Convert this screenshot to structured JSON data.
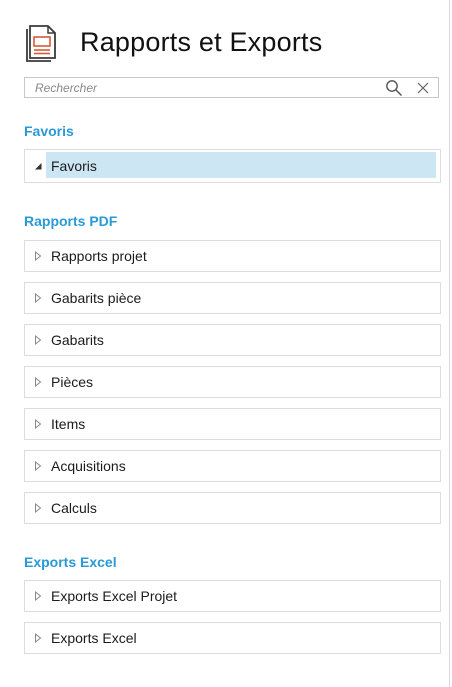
{
  "header": {
    "title": "Rapports et Exports",
    "icon": "report-document-icon"
  },
  "search": {
    "placeholder": "Rechercher",
    "value": "",
    "search_icon": "search-icon",
    "clear_icon": "close-icon"
  },
  "sections": {
    "favoris": {
      "title": "Favoris",
      "items": [
        {
          "label": "Favoris",
          "expanded": true
        }
      ]
    },
    "pdf": {
      "title": "Rapports PDF",
      "items": [
        {
          "label": "Rapports projet"
        },
        {
          "label": "Gabarits pièce"
        },
        {
          "label": "Gabarits"
        },
        {
          "label": "Pièces"
        },
        {
          "label": "Items"
        },
        {
          "label": "Acquisitions"
        },
        {
          "label": "Calculs"
        }
      ]
    },
    "excel": {
      "title": "Exports Excel",
      "items": [
        {
          "label": "Exports Excel Projet"
        },
        {
          "label": "Exports Excel"
        }
      ]
    }
  },
  "colors": {
    "accent": "#2a9ad6",
    "selection": "#cde6f3",
    "border": "#dcdcdc"
  }
}
